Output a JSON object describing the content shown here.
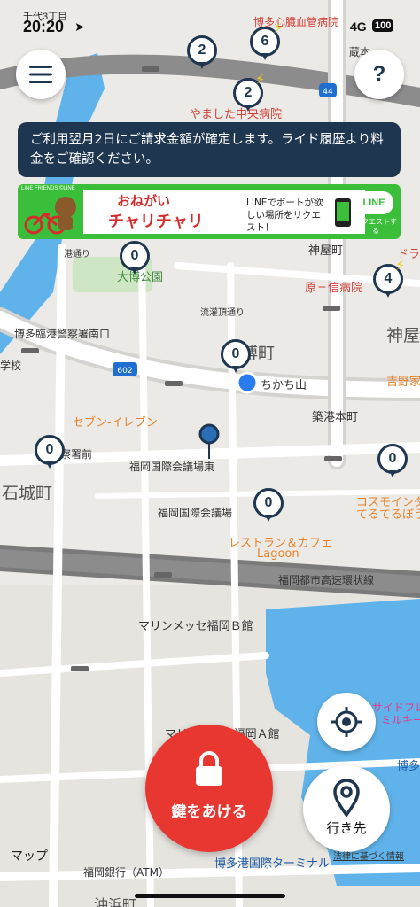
{
  "status_bar": {
    "back_app": "千代3丁目",
    "time": "20:20",
    "network": "4G",
    "battery": "100"
  },
  "menu_button": {
    "icon": "hamburger-icon"
  },
  "help_button": {
    "label": "?"
  },
  "notice": {
    "text": "ご利用翌月2日にご請求金額が確定します。ライド履歴より料金をご確認ください。"
  },
  "banner": {
    "brand": "LINE FRIENDS ©LINE",
    "line1": "おねがい",
    "line2": "チャリチャリ",
    "line3": "LINEでポートが欲しい場所をリクエスト！",
    "logo": "LINE",
    "action": "リクエストする"
  },
  "ports": [
    {
      "count": "2",
      "bolt": false
    },
    {
      "count": "6",
      "bolt": true
    },
    {
      "count": "2",
      "bolt": true
    },
    {
      "count": "0",
      "bolt": false
    },
    {
      "count": "4",
      "bolt": true
    },
    {
      "count": "0",
      "bolt": false
    },
    {
      "count": "0",
      "bolt": false
    },
    {
      "count": "0",
      "bolt": false
    },
    {
      "count": "0",
      "bolt": false
    }
  ],
  "map_labels": {
    "l1": "博多心臓血管病院",
    "l2": "蔵本",
    "l3": "やました中央病院",
    "l4": "神屋町",
    "l5": "原三信病院",
    "l6": "神屋",
    "l7": "大博公園",
    "l8": "流灌頂通り",
    "l9": "博多臨港警察署南口",
    "l10": "博町",
    "l11": "ちかち山",
    "l12": "吉野家",
    "l13": "築港本町",
    "l14": "セブン-イレブン",
    "l15": "福岡国際会議場東",
    "l16": "石城町",
    "l17": "福岡国際会議場",
    "l18": "コスモインダ",
    "l19": "てるてるぼう",
    "l20": "レストラン＆カフェ",
    "l21": "Lagoon",
    "l22": "福岡都市高速環状線",
    "l23": "マリンメッセ福岡Ｂ館",
    "l24": "マリンメッセ福岡Ａ館",
    "l25": "サイドフレ",
    "l26": "ミルキー",
    "l27": "博多",
    "l28": "福岡銀行（ATM）",
    "l29": "博多港国際ターミナル",
    "l30": "沖浜町",
    "l31": "602",
    "l32": "44",
    "l33": "察署前",
    "l34": "学校",
    "l35": "ドラ",
    "l36": "港通り"
  },
  "unlock_button": {
    "label": "鍵をあける"
  },
  "locate_button": {
    "icon": "crosshair-icon"
  },
  "destination_button": {
    "label": "行き先"
  },
  "maps_logo": "マップ",
  "legal_link": "法律に基づく情報",
  "colors": {
    "navy": "#1e3650",
    "red": "#e83631",
    "line_green": "#3bbf3b",
    "sea": "#5fb3ea"
  }
}
